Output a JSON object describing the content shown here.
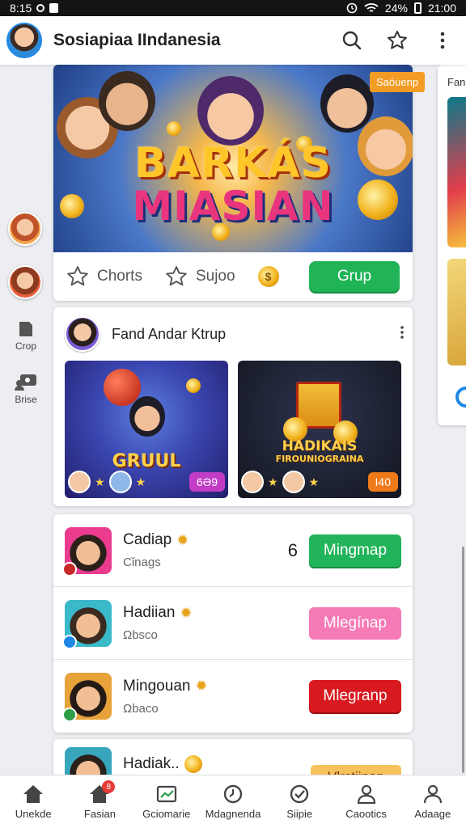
{
  "status_bar": {
    "time_left": "8:15",
    "battery": "24%",
    "time_right": "21:00"
  },
  "app_bar": {
    "title": "Sosiapiaa IIndanesia",
    "icons": [
      "search-icon",
      "star-icon",
      "more-vertical-icon"
    ]
  },
  "left_rail": {
    "items": [
      {
        "label": "Crop",
        "icon": "page-icon"
      },
      {
        "label": "Brise",
        "icon": "chat-person-icon"
      }
    ]
  },
  "hero": {
    "title_line1": "BARKÁS",
    "title_line2": "MIASIAN",
    "badge": "Saóuenp",
    "actions": {
      "charts": "Chorts",
      "support": "Sujoo",
      "coin": "$"
    },
    "button": "Grup"
  },
  "side_card": {
    "label": "Fand"
  },
  "group_card": {
    "title": "Fand Andar Ktrup",
    "tiles": [
      {
        "label": "GRUUL",
        "pill": "6Ə9"
      },
      {
        "label": "HADIKAIS",
        "sublabel": "FIROUNIOGRAINA",
        "pill": "I40"
      }
    ]
  },
  "list": [
    {
      "name": "Cadiap",
      "sub": "Cǐnags",
      "count": "6",
      "button": "Mingmap",
      "button_style": "green"
    },
    {
      "name": "Hadiian",
      "sub": "Ωbsco",
      "count": "",
      "button": "Mlegínap",
      "button_style": "pink"
    },
    {
      "name": "Mingouan",
      "sub": "Ωbaco",
      "count": "",
      "button": "Mlegranp",
      "button_style": "red"
    }
  ],
  "partial_row": {
    "name": "Hadiak..",
    "button": "Vlrctiinap"
  },
  "bottom_nav": [
    {
      "label": "Unekde",
      "icon": "home-icon"
    },
    {
      "label": "Fasian",
      "icon": "home-badge-icon",
      "badge": "8"
    },
    {
      "label": "Gciomarie",
      "icon": "chart-box-icon"
    },
    {
      "label": "Mdagnenda",
      "icon": "clock-icon"
    },
    {
      "label": "Siipie",
      "icon": "check-circle-icon"
    },
    {
      "label": "Caootics",
      "icon": "person-icon"
    },
    {
      "label": "Adaage",
      "icon": "profile-icon"
    }
  ]
}
